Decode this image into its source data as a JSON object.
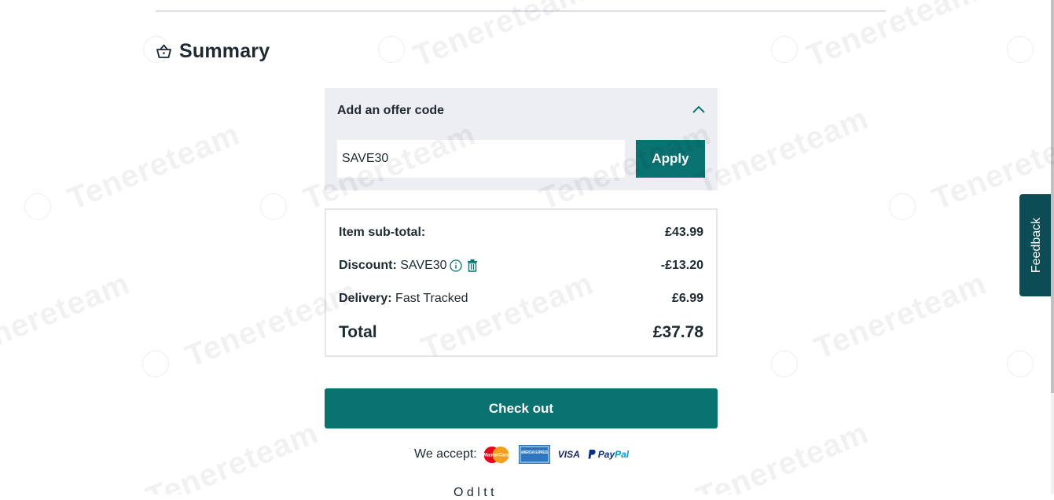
{
  "summary": {
    "title": "Summary",
    "icon": "basket-icon"
  },
  "offer": {
    "title": "Add an offer code",
    "code_value": "SAVE30",
    "apply_label": "Apply"
  },
  "totals": {
    "subtotal_label": "Item sub-total:",
    "subtotal_value": "£43.99",
    "discount_label": "Discount:",
    "discount_code": "SAVE30",
    "discount_value": "-£13.20",
    "delivery_label": "Delivery:",
    "delivery_method": "Fast Tracked",
    "delivery_value": "£6.99",
    "total_label": "Total",
    "total_value": "£37.78"
  },
  "checkout_label": "Check out",
  "payments": {
    "label": "We accept:",
    "methods": [
      "mastercard-logo",
      "american-express-logo",
      "visa-logo",
      "paypal-logo"
    ],
    "mastercard_text": "MasterCard",
    "amex_text": "AMERICAN EXPRESS",
    "visa_text": "VISA",
    "paypal_pay": "Pay",
    "paypal_pal": "Pal"
  },
  "bottom_cut_text": "O   d  l   t         t",
  "feedback_label": "Feedback",
  "watermark_text": "Tenereteam",
  "colors": {
    "accent": "#0b7272",
    "panel": "#eceef3",
    "feedback": "#0c4c55",
    "text": "#1e2a32"
  }
}
